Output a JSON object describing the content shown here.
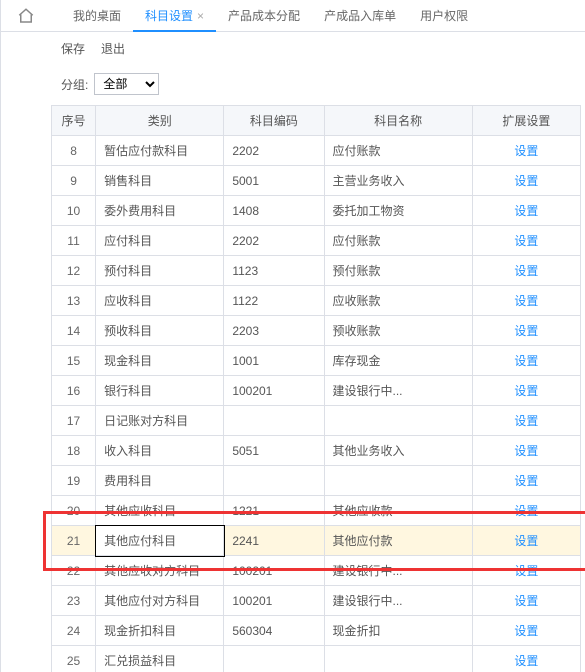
{
  "tabs": [
    "我的桌面",
    "科目设置",
    "产品成本分配",
    "产成品入库单",
    "用户权限"
  ],
  "active_tab": 1,
  "toolbar": {
    "save": "保存",
    "exit": "退出"
  },
  "filter": {
    "label": "分组:",
    "value": "全部"
  },
  "columns": {
    "idx": "序号",
    "cat": "类别",
    "code": "科目编码",
    "name": "科目名称",
    "ext": "扩展设置"
  },
  "action_label": "设置",
  "selected_idx": 21,
  "highlight_rows": [
    20,
    22
  ],
  "rows": [
    {
      "idx": 8,
      "cat": "暂估应付款科目",
      "code": "2202",
      "name": "应付账款"
    },
    {
      "idx": 9,
      "cat": "销售科目",
      "code": "5001",
      "name": "主营业务收入"
    },
    {
      "idx": 10,
      "cat": "委外费用科目",
      "code": "1408",
      "name": "委托加工物资"
    },
    {
      "idx": 11,
      "cat": "应付科目",
      "code": "2202",
      "name": "应付账款"
    },
    {
      "idx": 12,
      "cat": "预付科目",
      "code": "1123",
      "name": "预付账款"
    },
    {
      "idx": 13,
      "cat": "应收科目",
      "code": "1122",
      "name": "应收账款"
    },
    {
      "idx": 14,
      "cat": "预收科目",
      "code": "2203",
      "name": "预收账款"
    },
    {
      "idx": 15,
      "cat": "现金科目",
      "code": "1001",
      "name": "库存现金"
    },
    {
      "idx": 16,
      "cat": "银行科目",
      "code": "100201",
      "name": "建设银行中..."
    },
    {
      "idx": 17,
      "cat": "日记账对方科目",
      "code": "",
      "name": ""
    },
    {
      "idx": 18,
      "cat": "收入科目",
      "code": "5051",
      "name": "其他业务收入"
    },
    {
      "idx": 19,
      "cat": "费用科目",
      "code": "",
      "name": ""
    },
    {
      "idx": 20,
      "cat": "其他应收科目",
      "code": "1221",
      "name": "其他应收款"
    },
    {
      "idx": 21,
      "cat": "其他应付科目",
      "code": "2241",
      "name": "其他应付款"
    },
    {
      "idx": 22,
      "cat": "其他应收对方科目",
      "code": "100201",
      "name": "建设银行中..."
    },
    {
      "idx": 23,
      "cat": "其他应付对方科目",
      "code": "100201",
      "name": "建设银行中..."
    },
    {
      "idx": 24,
      "cat": "现金折扣科目",
      "code": "560304",
      "name": "现金折扣"
    },
    {
      "idx": 25,
      "cat": "汇兑损益科目",
      "code": "",
      "name": ""
    }
  ]
}
